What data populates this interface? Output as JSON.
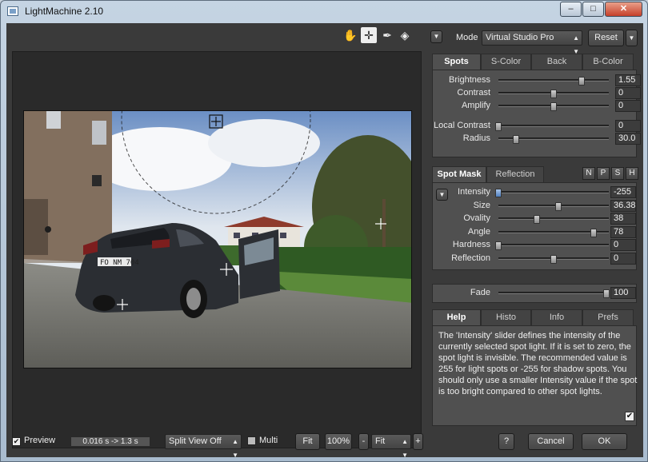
{
  "window": {
    "title": "LightMachine 2.10",
    "min": "–",
    "max": "□",
    "close": "✕"
  },
  "toolbar": {
    "hand": "✋",
    "move": "✛",
    "picker": "✒",
    "split": "◈"
  },
  "mode": {
    "menu_glyph": "▼",
    "label": "Mode",
    "value": "Virtual Studio Pro",
    "reset": "Reset",
    "reset_menu": "▼"
  },
  "spot_tabs": [
    "Spots",
    "S-Color",
    "Back",
    "B-Color"
  ],
  "spots": [
    {
      "label": "Brightness",
      "value": "1.55",
      "pos": 0.75
    },
    {
      "label": "Contrast",
      "value": "0",
      "pos": 0.5
    },
    {
      "label": "Amplify",
      "value": "0",
      "pos": 0.5
    },
    {
      "label": "Local Contrast",
      "value": "0",
      "pos": 0.0
    },
    {
      "label": "Radius",
      "value": "30.0",
      "pos": 0.16
    }
  ],
  "mask_tabs": [
    "Spot Mask",
    "Reflection"
  ],
  "mask_buttons": [
    "N",
    "P",
    "S",
    "H"
  ],
  "mask_menu": "▼",
  "mask": [
    {
      "label": "Intensity",
      "value": "-255",
      "pos": 0.0,
      "blue": true
    },
    {
      "label": "Size",
      "value": "36.38",
      "pos": 0.54
    },
    {
      "label": "Ovality",
      "value": "38",
      "pos": 0.35
    },
    {
      "label": "Angle",
      "value": "78",
      "pos": 0.86
    },
    {
      "label": "Hardness",
      "value": "0",
      "pos": 0.0
    },
    {
      "label": "Reflection",
      "value": "0",
      "pos": 0.5
    }
  ],
  "fade": {
    "label": "Fade",
    "value": "100",
    "pos": 0.98
  },
  "help_tabs": [
    "Help",
    "Histo",
    "Info",
    "Prefs"
  ],
  "help_text": "The 'Intensity' slider defines the intensity of the currently selected spot light. If it is set to zero, the spot light is invisible. The recommended value is 255 for light spots or -255 for shadow spots. You should only use a smaller Intensity value if the spot is too bright compared to other spot lights.",
  "help_checked": "✔",
  "bottom": {
    "preview_check": "✔",
    "preview": "Preview",
    "timing": "0.016 s -> 1.3 s",
    "split_view": "Split View Off",
    "multi": "Multi",
    "fit_btn": "Fit",
    "zoom": "100%",
    "minus": "-",
    "zoom_select": "Fit",
    "plus": "+",
    "help_btn": "?",
    "cancel": "Cancel",
    "ok": "OK"
  },
  "photo": {
    "plate": "FO NM 704"
  }
}
